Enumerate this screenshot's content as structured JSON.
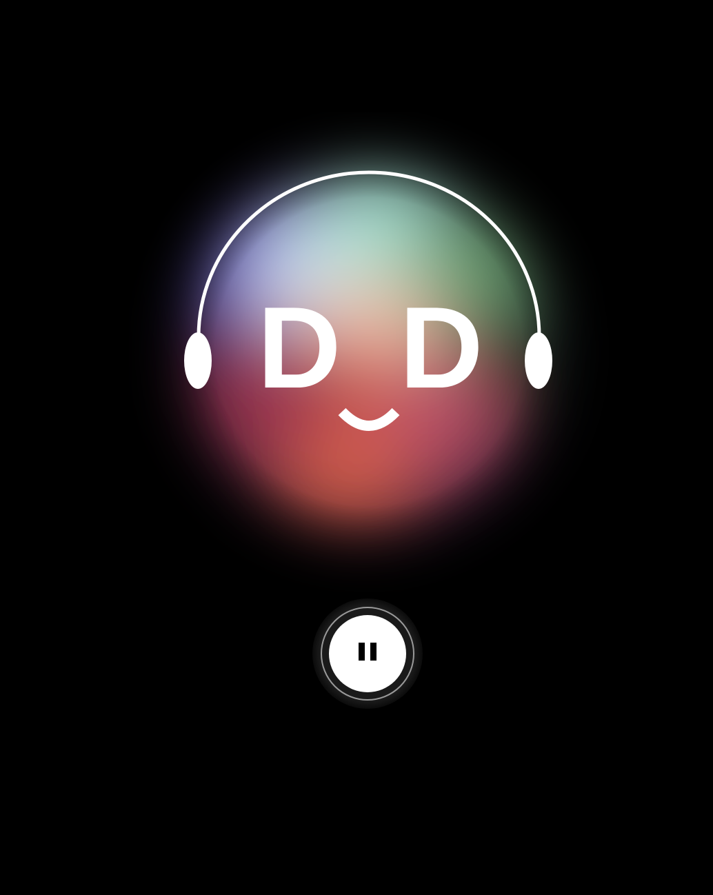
{
  "colors": {
    "background": "#000000",
    "logo": "#ffffff",
    "orb_purple": "#7b6bd6",
    "orb_teal": "#a8e0d0",
    "orb_green": "#6fa56a",
    "orb_red": "#d8604a",
    "orb_pink": "#e59a8a",
    "pause_button": "#ffffff",
    "pause_icon": "#000000"
  },
  "logo": {
    "left_letter": "D",
    "right_letter": "D",
    "icon": "headphones-smiley-icon"
  },
  "player": {
    "state": "playing",
    "button_icon": "pause-icon"
  }
}
